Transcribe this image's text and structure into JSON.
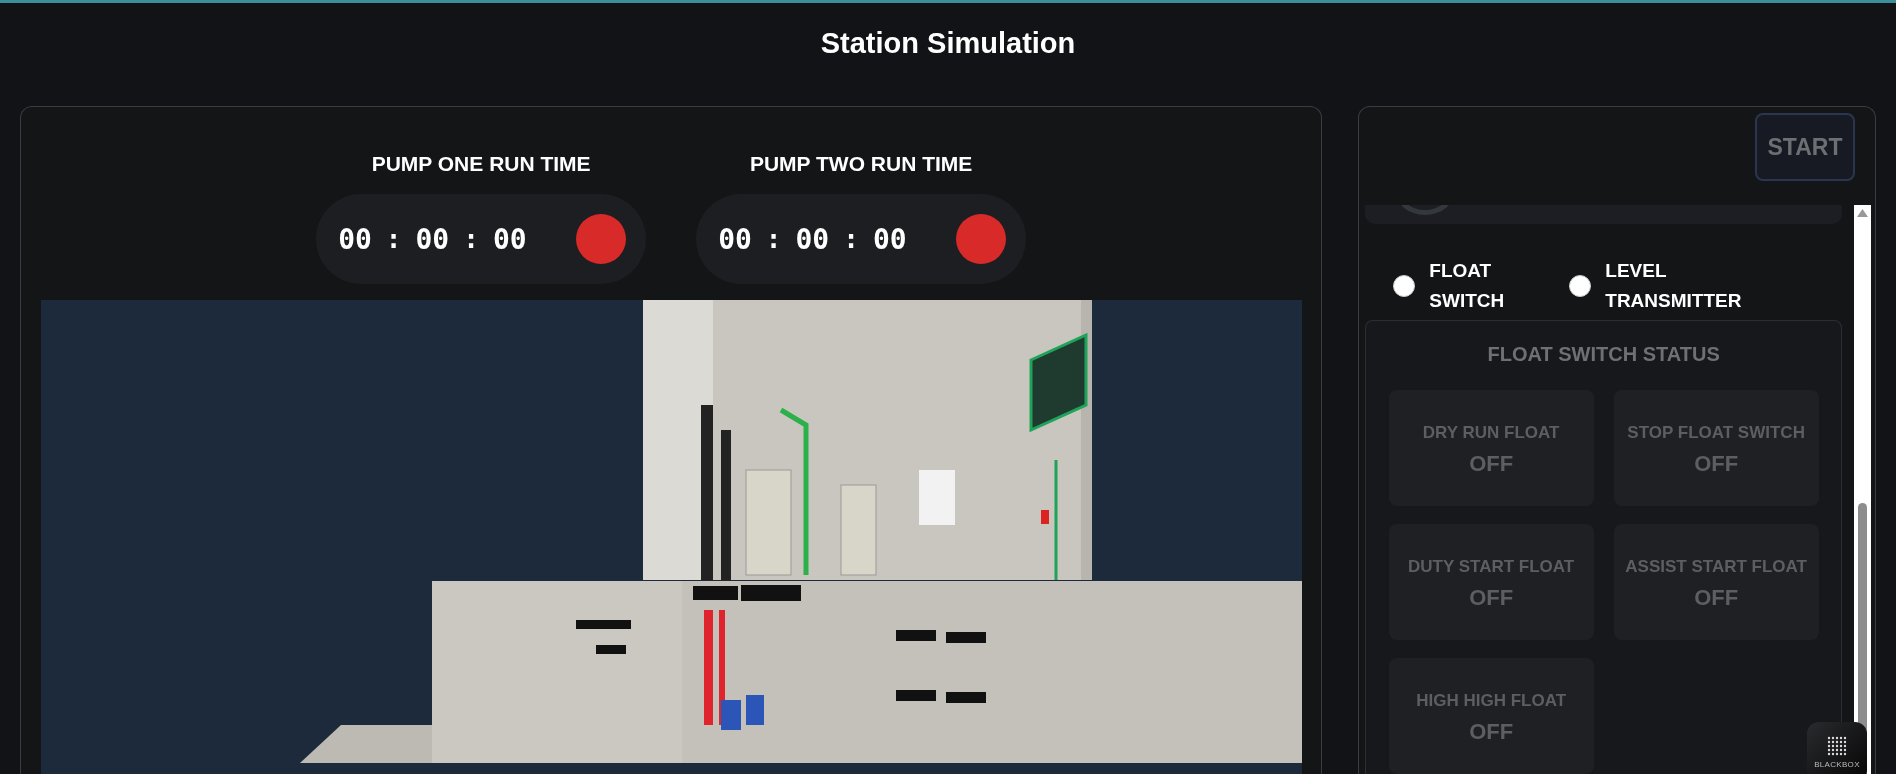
{
  "header": {
    "title": "Station Simulation"
  },
  "timers": [
    {
      "label": "PUMP ONE RUN TIME",
      "hours": "00",
      "minutes": "00",
      "seconds": "00",
      "separator": ":",
      "running": false
    },
    {
      "label": "PUMP TWO RUN TIME",
      "hours": "00",
      "minutes": "00",
      "seconds": "00",
      "separator": ":",
      "running": false
    }
  ],
  "control_panel": {
    "start_button": "START",
    "sensor_modes": [
      {
        "label": "FLOAT SWITCH",
        "selected": false
      },
      {
        "label": "LEVEL TRANSMITTER",
        "selected": false
      }
    ],
    "float_status": {
      "title": "FLOAT SWITCH STATUS",
      "switches": [
        {
          "label": "DRY RUN FLOAT",
          "value": "OFF",
          "on": false
        },
        {
          "label": "STOP FLOAT SWITCH",
          "value": "OFF",
          "on": false
        },
        {
          "label": "DUTY START FLOAT",
          "value": "OFF",
          "on": false
        },
        {
          "label": "ASSIST START FLOAT",
          "value": "OFF",
          "on": false
        },
        {
          "label": "HIGH HIGH FLOAT",
          "value": "OFF",
          "on": false
        }
      ]
    }
  },
  "assistant_badge": {
    "label": "BLACKBOX"
  }
}
